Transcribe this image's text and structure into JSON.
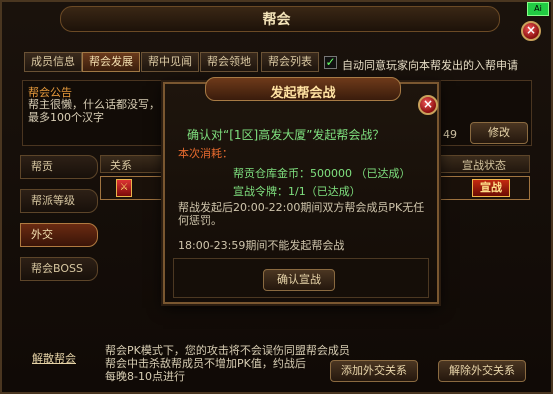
{
  "window": {
    "title": "帮会"
  },
  "tabs": [
    "成员信息",
    "帮会发展",
    "帮中见闻",
    "帮会领地",
    "帮会列表"
  ],
  "auto_approve": {
    "label": "自动同意玩家向本帮发出的入帮申请",
    "checked": true
  },
  "announcement": {
    "title": "帮会公告",
    "text": "帮主很懒，什么话都没写，最多100个汉字",
    "count": "49",
    "edit_button": "修改"
  },
  "side_menu": [
    "帮贡",
    "帮派等级",
    "外交",
    "帮会BOSS"
  ],
  "table": {
    "headers": [
      "关系",
      "宣战状态"
    ],
    "row_action": "宣战"
  },
  "bottom": {
    "disband_link": "解散帮会",
    "notes": [
      "帮会PK模式下，您的攻击将不会误伤同盟帮会成员",
      "帮会中击杀敌帮成员不增加PK值，约战后",
      "每晚8-10点进行"
    ],
    "add_diplomacy": "添加外交关系",
    "remove_diplomacy": "解除外交关系"
  },
  "dialog": {
    "title": "发起帮会战",
    "question": "确认对“[1区]高发大厦”发起帮会战？",
    "cost_label": "本次消耗：",
    "cost_gold": "帮贡仓库金币：500000 （已达成）",
    "cost_token": "宣战令牌：1/1（已达成）",
    "description": "帮战发起后20:00-22:00期间双方帮会成员PK无任何惩罚。",
    "time_note": "18:00-23:59期间不能发起帮会战",
    "confirm_button": "确认宣战"
  },
  "corner_badge": "Ai"
}
